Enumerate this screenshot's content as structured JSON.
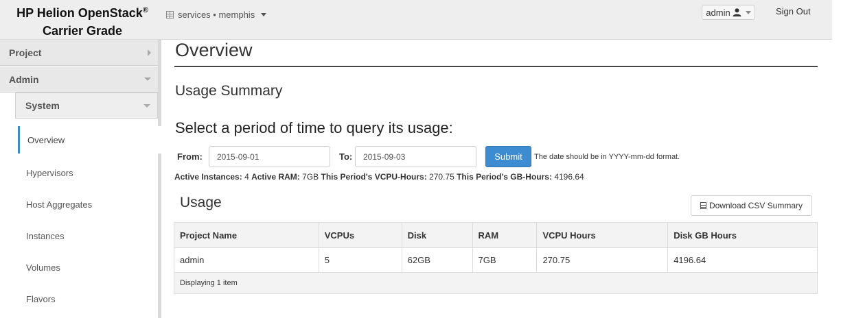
{
  "header": {
    "brand_line1": "HP Helion OpenStack",
    "brand_reg": "®",
    "brand_line2": "Carrier Grade",
    "context": "services • memphis",
    "user": "admin",
    "sign_out": "Sign Out"
  },
  "sidebar": {
    "project": "Project",
    "admin": "Admin",
    "system": "System",
    "items": [
      {
        "label": "Overview",
        "active": true
      },
      {
        "label": "Hypervisors"
      },
      {
        "label": "Host Aggregates"
      },
      {
        "label": "Instances"
      },
      {
        "label": "Volumes"
      },
      {
        "label": "Flavors"
      }
    ]
  },
  "main": {
    "page_title": "Overview",
    "usage_summary_title": "Usage Summary",
    "query_title": "Select a period of time to query its usage:",
    "from_label": "From:",
    "from_value": "2015-09-01",
    "to_label": "To:",
    "to_value": "2015-09-03",
    "submit_label": "Submit",
    "date_hint": "The date should be in YYYY-mm-dd format.",
    "stats": {
      "active_instances_label": "Active Instances:",
      "active_instances": "4",
      "active_ram_label": "Active RAM:",
      "active_ram": "7GB",
      "vcpu_hours_label": "This Period's VCPU-Hours:",
      "vcpu_hours": "270.75",
      "gb_hours_label": "This Period's GB-Hours:",
      "gb_hours": "4196.64"
    },
    "usage_title": "Usage",
    "download_csv": "Download CSV Summary",
    "table": {
      "headers": [
        "Project Name",
        "VCPUs",
        "Disk",
        "RAM",
        "VCPU Hours",
        "Disk GB Hours"
      ],
      "rows": [
        [
          "admin",
          "5",
          "62GB",
          "7GB",
          "270.75",
          "4196.64"
        ]
      ],
      "footer": "Displaying 1 item"
    }
  }
}
